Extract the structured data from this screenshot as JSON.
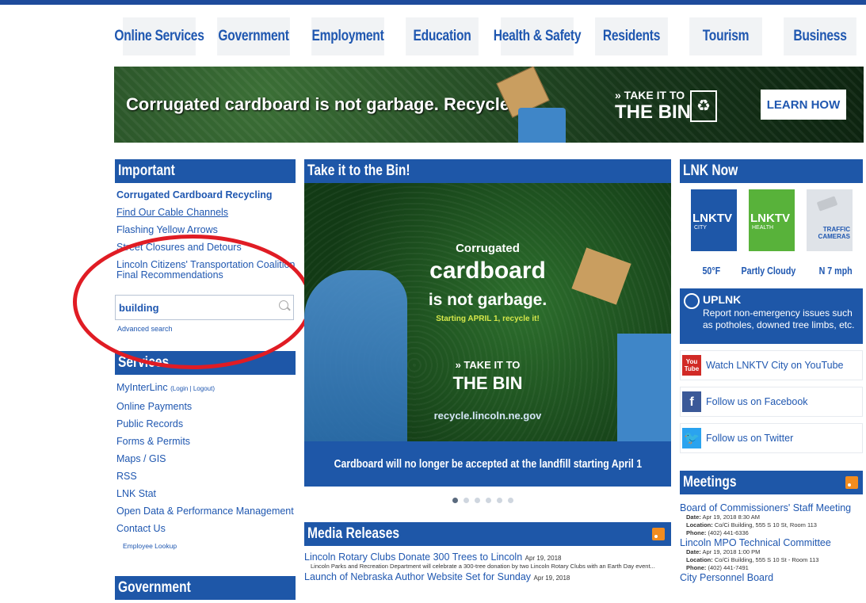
{
  "nav": [
    "Online Services",
    "Government",
    "Employment",
    "Education",
    "Health & Safety",
    "Residents",
    "Tourism",
    "Business"
  ],
  "hero": {
    "headline": "Corrugated cardboard is not garbage. Recycle it!",
    "take_small": "» TAKE IT TO",
    "take_big": "THE BIN",
    "recycle_symbol": "♻",
    "cta": "LEARN HOW"
  },
  "important": {
    "title": "Important",
    "links": [
      {
        "label": "Corrugated Cardboard Recycling",
        "style": "bold"
      },
      {
        "label": "Find Our Cable Channels",
        "style": "ul"
      },
      {
        "label": "Flashing Yellow Arrows",
        "style": ""
      },
      {
        "label": "Street Closures and Detours",
        "style": ""
      },
      {
        "label": "Lincoln Citizens' Transportation Coalition",
        "style": ""
      },
      {
        "label": "Final Recommendations",
        "style": ""
      }
    ]
  },
  "search": {
    "value": "building",
    "advanced": "Advanced search"
  },
  "services": {
    "title": "Services",
    "myinterlinc": "MyInterLinc",
    "login": "(Login | Logout)",
    "items": [
      "Online Payments",
      "Public Records",
      "Forms & Permits",
      "Maps / GIS",
      "RSS",
      "LNK Stat",
      "Open Data & Performance Management",
      "Contact Us"
    ],
    "employee": "Employee Lookup"
  },
  "government": {
    "title": "Government"
  },
  "slide": {
    "header": "Take it to the Bin!",
    "line1": "Corrugated",
    "line2": "cardboard",
    "line3": "is not garbage.",
    "line4": "Starting APRIL 1, recycle it!",
    "line5": "» TAKE IT TO",
    "line6": "THE BIN",
    "url": "recycle.lincoln.ne.gov",
    "caption": "Cardboard will no longer be accepted at the landfill starting April 1",
    "dots_total": 6,
    "dot_active": 0
  },
  "media": {
    "title": "Media Releases",
    "items": [
      {
        "title": "Lincoln Rotary Clubs Donate 300 Trees to Lincoln",
        "date": "Apr 19, 2018",
        "desc": "Lincoln Parks and Recreation Department will celebrate a 300-tree donation by two Lincoln Rotary Clubs with an Earth Day event..."
      },
      {
        "title": "Launch of Nebraska Author Website Set for Sunday",
        "date": "Apr 19, 2018",
        "desc": ""
      }
    ]
  },
  "lnk_now": {
    "title": "LNK Now",
    "tiles": [
      {
        "label": "LNKTV",
        "sub": "CITY",
        "color": "#1e57a8"
      },
      {
        "label": "LNKTV",
        "sub": "HEALTH",
        "color": "#58b23a"
      },
      {
        "label": "TRAFFIC CAMERAS",
        "sub": "",
        "color": "#dfe3e8"
      }
    ],
    "weather": {
      "temp": "50°F",
      "cond": "Partly Cloudy",
      "wind": "N 7 mph"
    },
    "uplnk": {
      "title": "UPLNK",
      "text": "Report non-emergency issues such as potholes, downed tree limbs, etc."
    },
    "social": [
      {
        "icon": "youtube-icon",
        "badge": "You Tube",
        "label": "Watch LNKTV City on YouTube",
        "color": "#d12a26"
      },
      {
        "icon": "facebook-icon",
        "badge": "f",
        "label": "Follow us on Facebook",
        "color": "#3b5998"
      },
      {
        "icon": "twitter-icon",
        "badge": "🐦",
        "label": "Follow us on Twitter",
        "color": "#2aa3ef"
      }
    ]
  },
  "meetings": {
    "title": "Meetings",
    "items": [
      {
        "title": "Board of Commissioners' Staff Meeting",
        "date": "Apr 19, 2018 8:30 AM",
        "location": "Co/Ci Building, 555 S 10 St, Room 113",
        "phone": "(402) 441-6336"
      },
      {
        "title": "Lincoln MPO Technical Committee",
        "date": "Apr 19, 2018 1:00 PM",
        "location": "Co/Ci Building, 555 S 10 St - Room 113",
        "phone": "(402) 441-7491"
      },
      {
        "title": "City Personnel Board",
        "date": "",
        "location": "",
        "phone": ""
      }
    ],
    "labels": {
      "date": "Date:",
      "location": "Location:",
      "phone": "Phone:"
    }
  }
}
